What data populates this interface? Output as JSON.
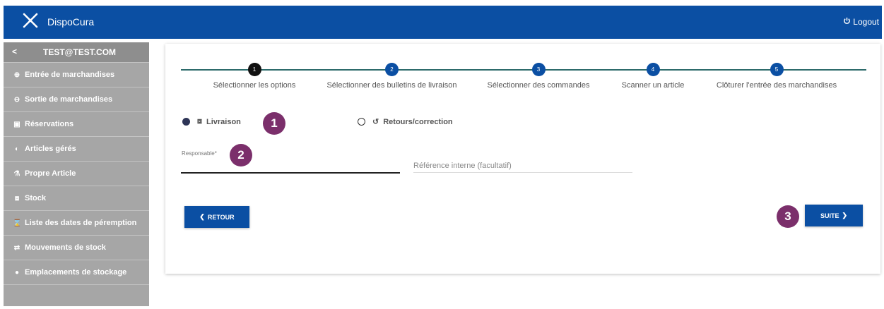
{
  "header": {
    "brand": "DispoCura",
    "logout_label": "Logout"
  },
  "sidebar": {
    "back_icon": "chevron-left-icon",
    "user": "TEST@TEST.COM",
    "items": [
      {
        "label": "Entrée de marchandises",
        "icon": "plus-circle-icon"
      },
      {
        "label": "Sortie de marchandises",
        "icon": "minus-circle-icon"
      },
      {
        "label": "Réservations",
        "icon": "calendar-icon"
      },
      {
        "label": "Articles gérés",
        "icon": "pill-icon"
      },
      {
        "label": "Propre Article",
        "icon": "flask-icon"
      },
      {
        "label": "Stock",
        "icon": "cubes-icon"
      },
      {
        "label": "Liste des dates de péremption",
        "icon": "hourglass-icon"
      },
      {
        "label": "Mouvements de stock",
        "icon": "exchange-icon"
      },
      {
        "label": "Emplacements de stockage",
        "icon": "map-marker-icon"
      }
    ]
  },
  "stepper": {
    "steps": [
      {
        "num": "1",
        "label": "Sélectionner les options",
        "active": true
      },
      {
        "num": "2",
        "label": "Sélectionner des bulletins de livraison",
        "active": false
      },
      {
        "num": "3",
        "label": "Sélectionner des commandes",
        "active": false
      },
      {
        "num": "4",
        "label": "Scanner un article",
        "active": false
      },
      {
        "num": "5",
        "label": "Clôturer l'entrée des marchandises",
        "active": false
      }
    ]
  },
  "options": {
    "livraison_label": "Livraison",
    "retours_label": "Retours/correction",
    "selected": "livraison"
  },
  "form": {
    "responsable_label": "Responsable*",
    "responsable_value": "",
    "reference_placeholder": "Référence interne (facultatif)"
  },
  "buttons": {
    "retour_label": "RETOUR",
    "suite_label": "SUITE"
  },
  "annotations": {
    "badge1": "1",
    "badge2": "2",
    "badge3": "3"
  },
  "colors": {
    "primary": "#0b4fa3",
    "sidebar": "#a6a6a6",
    "badge": "#7b2f6b"
  }
}
